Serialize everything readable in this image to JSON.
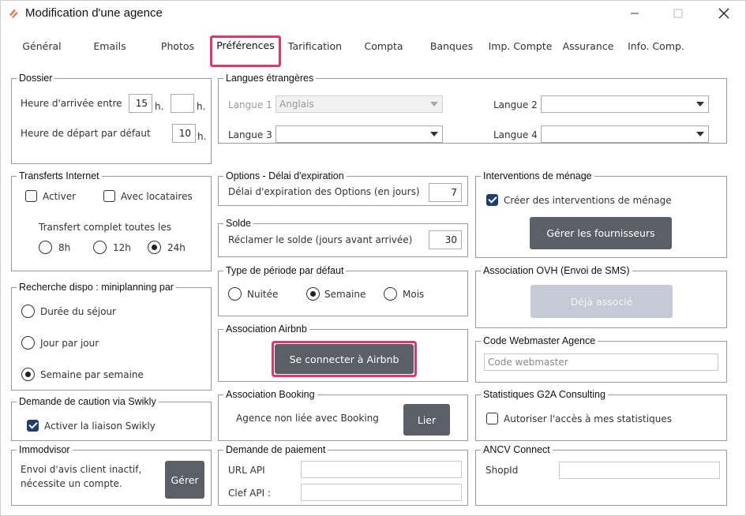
{
  "window": {
    "title": "Modification d'une agence"
  },
  "tabs": [
    {
      "label": "Général"
    },
    {
      "label": "Emails"
    },
    {
      "label": "Photos"
    },
    {
      "label": "Préférences"
    },
    {
      "label": "Tarification"
    },
    {
      "label": "Compta"
    },
    {
      "label": "Banques"
    },
    {
      "label": "Imp. Compte"
    },
    {
      "label": "Assurance"
    },
    {
      "label": "Info. Comp."
    }
  ],
  "active_tab": "Préférences",
  "dossier": {
    "title": "Dossier",
    "arrival_label": "Heure d'arrivée entre",
    "arrival_from": "15",
    "arrival_to": "",
    "h_unit": "h.",
    "departure_label": "Heure de départ par défaut",
    "departure_value": "10"
  },
  "langues": {
    "title": "Langues étrangères",
    "l1_label": "Langue 1",
    "l1_value": "Anglais",
    "l2_label": "Langue 2",
    "l2_value": "",
    "l3_label": "Langue 3",
    "l3_value": "",
    "l4_label": "Langue 4",
    "l4_value": ""
  },
  "transferts": {
    "title": "Transferts Internet",
    "activer": "Activer",
    "avec_locataires": "Avec locataires",
    "complet_label": "Transfert complet toutes les",
    "options": [
      "8h",
      "12h",
      "24h"
    ],
    "selected": "24h"
  },
  "options_expiration": {
    "title": "Options  -  Délai d'expiration",
    "label": "Délai d'expiration des Options (en jours)",
    "value": "7"
  },
  "menage": {
    "title": "Interventions de ménage",
    "checkbox": "Créer des interventions de ménage",
    "checked": true,
    "button": "Gérer les fournisseurs"
  },
  "solde": {
    "title": "Solde",
    "label": "Réclamer le solde (jours avant arrivée)",
    "value": "30"
  },
  "recherche": {
    "title": "Recherche dispo : miniplanning par",
    "options": [
      "Durée du séjour",
      "Jour par jour",
      "Semaine par semaine"
    ],
    "selected": "Semaine par semaine"
  },
  "periode": {
    "title": "Type de période par défaut",
    "options": [
      "Nuitée",
      "Semaine",
      "Mois"
    ],
    "selected": "Semaine"
  },
  "ovh": {
    "title": "Association OVH (Envoi de SMS)",
    "button": "Déjà associé"
  },
  "airbnb": {
    "title": "Association Airbnb",
    "button": "Se connecter à Airbnb"
  },
  "webmaster": {
    "title": "Code Webmaster Agence",
    "placeholder": "Code webmaster"
  },
  "swikly": {
    "title": "Demande de caution via Swikly",
    "checkbox": "Activer la liaison Swikly",
    "checked": true
  },
  "booking": {
    "title": "Association Booking",
    "status": "Agence non liée avec Booking",
    "button": "Lier"
  },
  "stats": {
    "title": "Statistiques G2A Consulting",
    "checkbox": "Autoriser l'accès à mes statistiques",
    "checked": false
  },
  "immodvisor": {
    "title": "Immodvisor",
    "line1": "Envoi d'avis client inactif,",
    "line2": "nécessite un compte.",
    "button": "Gérer"
  },
  "paiement": {
    "title": "Demande de paiement",
    "url_label": "URL API",
    "url_value": "",
    "clef_label": "Clef API :",
    "clef_value": ""
  },
  "ancv": {
    "title": "ANCV Connect",
    "shopid_label": "ShopId",
    "shopid_value": ""
  },
  "colors": {
    "highlight": "#e0366a",
    "button": "#5b6068",
    "button_disabled": "#c5cbd6",
    "check": "#1f3d6e",
    "app_icon": "#e8663d"
  },
  "icons": [
    "app-logo-icon",
    "minimize-icon",
    "maximize-icon",
    "close-icon",
    "dropdown-arrow-icon",
    "checkmark-icon"
  ]
}
